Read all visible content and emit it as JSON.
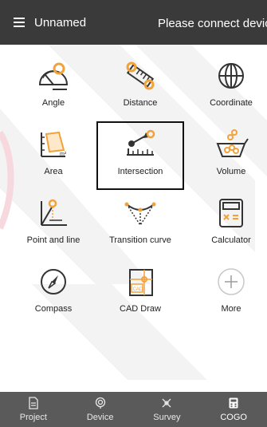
{
  "header": {
    "title": "Unnamed",
    "status": "Please connect device"
  },
  "tools": [
    {
      "label": "Angle",
      "icon": "angle-icon"
    },
    {
      "label": "Distance",
      "icon": "distance-icon"
    },
    {
      "label": "Coordinate",
      "icon": "coordinate-icon"
    },
    {
      "label": "Area",
      "icon": "area-icon"
    },
    {
      "label": "Intersection",
      "icon": "intersection-icon",
      "selected": true
    },
    {
      "label": "Volume",
      "icon": "volume-icon"
    },
    {
      "label": "Point and line",
      "icon": "point-line-icon"
    },
    {
      "label": "Transition curve",
      "icon": "transition-curve-icon"
    },
    {
      "label": "Calculator",
      "icon": "calculator-icon"
    },
    {
      "label": "Compass",
      "icon": "compass-icon"
    },
    {
      "label": "CAD Draw",
      "icon": "cad-draw-icon",
      "icon_text": "CAD"
    },
    {
      "label": "More",
      "icon": "plus-icon"
    }
  ],
  "area_unit": "m²",
  "bottom_nav": [
    {
      "label": "Project",
      "icon": "project-icon"
    },
    {
      "label": "Device",
      "icon": "device-icon"
    },
    {
      "label": "Survey",
      "icon": "survey-icon"
    },
    {
      "label": "COGO",
      "icon": "cogo-icon",
      "active": true
    }
  ],
  "colors": {
    "topbar": "#3a3a3a",
    "bottombar": "#5a5a5a",
    "accent": "#f2a23a",
    "icon_dark": "#333333"
  }
}
